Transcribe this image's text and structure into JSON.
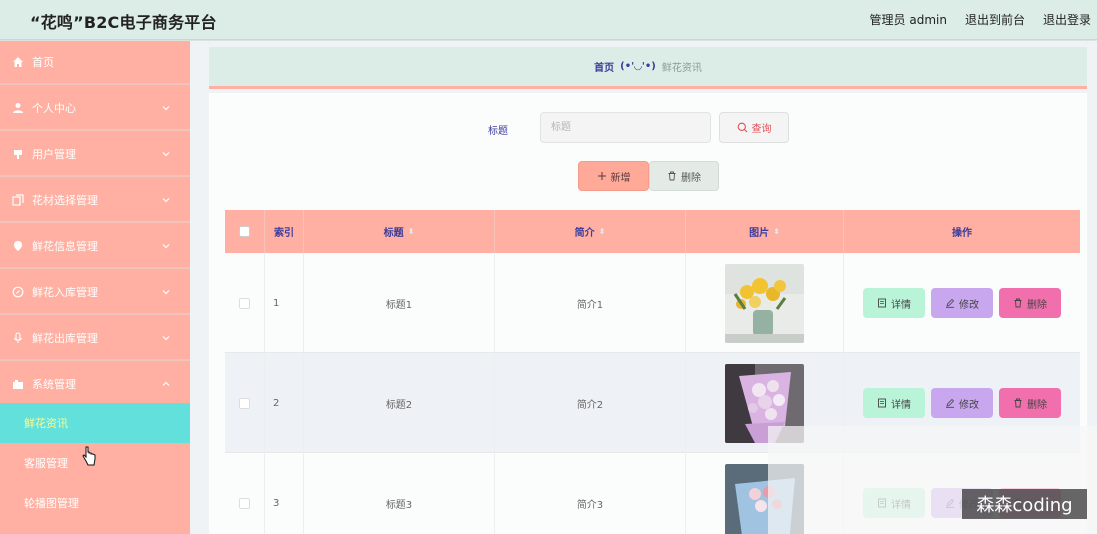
{
  "header": {
    "title": "“花鸣”B2C电子商务平台",
    "user": "管理员 admin",
    "front_link": "退出到前台",
    "logout_link": "退出登录"
  },
  "sidebar": {
    "items": [
      {
        "label": "首页",
        "icon": "home-icon",
        "expandable": false
      },
      {
        "label": "个人中心",
        "icon": "user-icon",
        "expandable": true
      },
      {
        "label": "用户管理",
        "icon": "pin-icon",
        "expandable": true
      },
      {
        "label": "花材选择管理",
        "icon": "copy-icon",
        "expandable": true
      },
      {
        "label": "鲜花信息管理",
        "icon": "location-icon",
        "expandable": true
      },
      {
        "label": "鲜花入库管理",
        "icon": "compass-icon",
        "expandable": true
      },
      {
        "label": "鲜花出库管理",
        "icon": "mic-icon",
        "expandable": true
      },
      {
        "label": "系统管理",
        "icon": "box-icon",
        "expandable": true,
        "expanded": true
      }
    ],
    "sub_items": [
      {
        "label": "鲜花资讯",
        "active": true
      },
      {
        "label": "客服管理",
        "active": false
      },
      {
        "label": "轮播图管理",
        "active": false
      }
    ]
  },
  "breadcrumb": {
    "home": "首页",
    "separator": "(•'◡'•)",
    "current": "鲜花资讯"
  },
  "search": {
    "label": "标题",
    "placeholder": "标题",
    "value": "",
    "query_button": "查询"
  },
  "toolbar": {
    "add_button": "新增",
    "delete_button": "删除"
  },
  "table": {
    "headers": {
      "index": "索引",
      "title": "标题",
      "intro": "简介",
      "image": "图片",
      "actions": "操作"
    },
    "rows": [
      {
        "index": "1",
        "title": "标题1",
        "intro": "简介1",
        "image": "yellow-flowers-vase"
      },
      {
        "index": "2",
        "title": "标题2",
        "intro": "简介2",
        "image": "pink-bouquet"
      },
      {
        "index": "3",
        "title": "标题3",
        "intro": "简介3",
        "image": "blue-bouquet"
      }
    ],
    "actions": {
      "detail": "详情",
      "edit": "修改",
      "delete": "删除"
    }
  },
  "watermark": "森森coding",
  "colors": {
    "header_bg": "#dcece6",
    "sidebar_bg": "#ffb0a2",
    "sidebar_active_bg": "#62e0dc",
    "sidebar_active_text": "#fffb8a",
    "accent_text": "#3d3d9c",
    "detail_btn": "#b9f4d8",
    "edit_btn": "#c9a7ee",
    "delete_btn": "#f26fae"
  }
}
